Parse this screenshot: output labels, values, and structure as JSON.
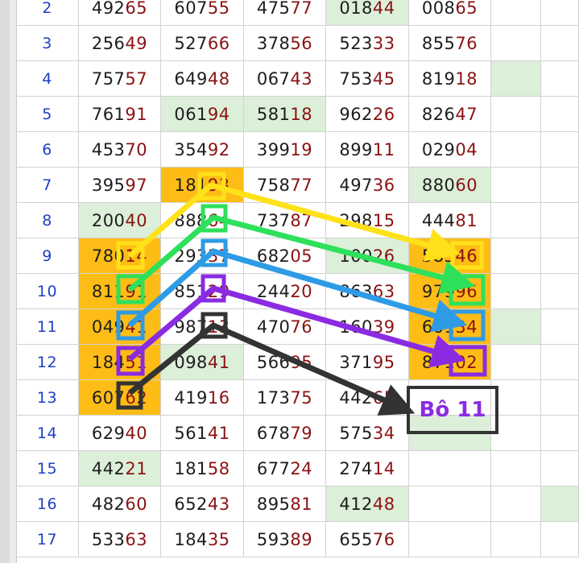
{
  "rows": [
    {
      "index": "2",
      "cells": [
        [
          "492",
          "65"
        ],
        [
          "607",
          "55"
        ],
        [
          "475",
          "77"
        ],
        [
          "018",
          "44"
        ],
        [
          "008",
          "65"
        ]
      ],
      "bg": [
        "",
        "",
        "",
        "green",
        ""
      ],
      "extra": [
        "",
        ""
      ]
    },
    {
      "index": "3",
      "cells": [
        [
          "256",
          "49"
        ],
        [
          "527",
          "66"
        ],
        [
          "378",
          "56"
        ],
        [
          "523",
          "33"
        ],
        [
          "855",
          "76"
        ]
      ],
      "bg": [
        "",
        "",
        "",
        "",
        ""
      ],
      "extra": [
        "",
        ""
      ]
    },
    {
      "index": "4",
      "cells": [
        [
          "757",
          "57"
        ],
        [
          "649",
          "48"
        ],
        [
          "067",
          "43"
        ],
        [
          "753",
          "45"
        ],
        [
          "819",
          "18"
        ]
      ],
      "bg": [
        "",
        "",
        "",
        "",
        ""
      ],
      "extra": [
        "green",
        ""
      ]
    },
    {
      "index": "5",
      "cells": [
        [
          "761",
          "91"
        ],
        [
          "061",
          "94"
        ],
        [
          "581",
          "18"
        ],
        [
          "962",
          "26"
        ],
        [
          "826",
          "47"
        ]
      ],
      "bg": [
        "",
        "green",
        "green",
        "",
        ""
      ],
      "extra": [
        "",
        ""
      ]
    },
    {
      "index": "6",
      "cells": [
        [
          "453",
          "70"
        ],
        [
          "354",
          "92"
        ],
        [
          "399",
          "19"
        ],
        [
          "899",
          "11"
        ],
        [
          "029",
          "04"
        ]
      ],
      "bg": [
        "",
        "",
        "",
        "",
        ""
      ],
      "extra": [
        "",
        ""
      ]
    },
    {
      "index": "7",
      "cells": [
        [
          "395",
          "97"
        ],
        [
          "181",
          "93"
        ],
        [
          "758",
          "77"
        ],
        [
          "497",
          "36"
        ],
        [
          "880",
          "60"
        ]
      ],
      "bg": [
        "",
        "orange",
        "",
        "",
        "green"
      ],
      "extra": [
        "",
        ""
      ]
    },
    {
      "index": "8",
      "cells": [
        [
          "200",
          "40"
        ],
        [
          "888",
          "64"
        ],
        [
          "737",
          "87"
        ],
        [
          "298",
          "15"
        ],
        [
          "444",
          "81"
        ]
      ],
      "bg": [
        "green",
        "",
        "",
        "",
        ""
      ],
      "extra": [
        "",
        ""
      ]
    },
    {
      "index": "9",
      "cells": [
        [
          "780",
          "14"
        ],
        [
          "293",
          "37"
        ],
        [
          "682",
          "05"
        ],
        [
          "100",
          "26"
        ],
        [
          "583",
          "46"
        ]
      ],
      "bg": [
        "orange",
        "",
        "",
        "green",
        "orange"
      ],
      "extra": [
        "",
        ""
      ]
    },
    {
      "index": "10",
      "cells": [
        [
          "811",
          "91"
        ],
        [
          "851",
          "29"
        ],
        [
          "244",
          "20"
        ],
        [
          "863",
          "63"
        ],
        [
          "979",
          "96"
        ]
      ],
      "bg": [
        "orange",
        "",
        "",
        "",
        "orange"
      ],
      "extra": [
        "",
        ""
      ]
    },
    {
      "index": "11",
      "cells": [
        [
          "049",
          "41"
        ],
        [
          "987",
          "13"
        ],
        [
          "470",
          "76"
        ],
        [
          "160",
          "39"
        ],
        [
          "601",
          "34"
        ]
      ],
      "bg": [
        "orange",
        "",
        "",
        "",
        "orange"
      ],
      "extra": [
        "green",
        ""
      ]
    },
    {
      "index": "12",
      "cells": [
        [
          "184",
          "51"
        ],
        [
          "098",
          "41"
        ],
        [
          "566",
          "95"
        ],
        [
          "371",
          "95"
        ],
        [
          "871",
          "02"
        ]
      ],
      "bg": [
        "orange",
        "green",
        "",
        "",
        "orange"
      ],
      "extra": [
        "",
        ""
      ]
    },
    {
      "index": "13",
      "cells": [
        [
          "607",
          "62"
        ],
        [
          "419",
          "16"
        ],
        [
          "173",
          "75"
        ],
        [
          "442",
          "65"
        ],
        [
          "",
          ""
        ]
      ],
      "bg": [
        "orange",
        "",
        "",
        "",
        ""
      ],
      "extra": [
        "",
        ""
      ]
    },
    {
      "index": "14",
      "cells": [
        [
          "629",
          "40"
        ],
        [
          "561",
          "41"
        ],
        [
          "678",
          "79"
        ],
        [
          "575",
          "34"
        ],
        [
          "",
          ""
        ]
      ],
      "bg": [
        "",
        "",
        "",
        "",
        "green"
      ],
      "extra": [
        "",
        ""
      ]
    },
    {
      "index": "15",
      "cells": [
        [
          "442",
          "21"
        ],
        [
          "181",
          "58"
        ],
        [
          "677",
          "24"
        ],
        [
          "274",
          "14"
        ],
        [
          "",
          ""
        ]
      ],
      "bg": [
        "green",
        "",
        "",
        "",
        ""
      ],
      "extra": [
        "",
        ""
      ]
    },
    {
      "index": "16",
      "cells": [
        [
          "482",
          "60"
        ],
        [
          "652",
          "43"
        ],
        [
          "895",
          "81"
        ],
        [
          "412",
          "48"
        ],
        [
          "",
          ""
        ]
      ],
      "bg": [
        "",
        "",
        "",
        "green",
        ""
      ],
      "extra": [
        "",
        "green"
      ]
    },
    {
      "index": "17",
      "cells": [
        [
          "533",
          "63"
        ],
        [
          "184",
          "35"
        ],
        [
          "593",
          "89"
        ],
        [
          "655",
          "76"
        ],
        [
          "",
          ""
        ]
      ],
      "bg": [
        "",
        "",
        "",
        "",
        ""
      ],
      "extra": [
        "",
        ""
      ]
    }
  ],
  "annotation": {
    "label": "Bô 11",
    "colors": {
      "yellow": "#ffe11a",
      "green": "#2ee05a",
      "blue": "#2e9be6",
      "purple": "#8a2be2",
      "black": "#333333"
    }
  }
}
